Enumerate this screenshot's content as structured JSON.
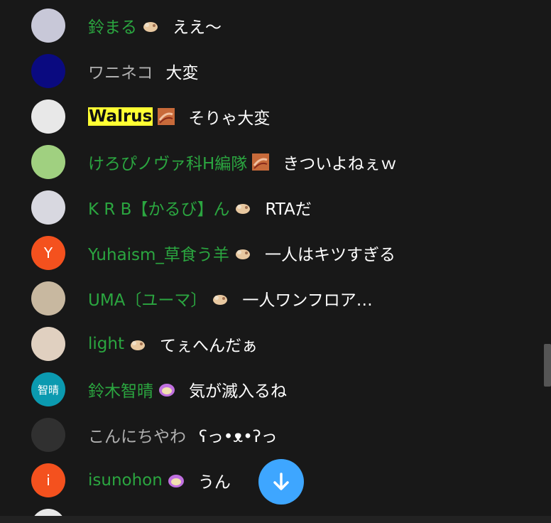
{
  "chat": {
    "messages": [
      {
        "author": "鈴まる",
        "badge": "member-badge-icon",
        "text": "ええ〜",
        "author_style": "member",
        "avatar": {
          "color": "#c8c8d8",
          "label": ""
        }
      },
      {
        "author": "ワニネコ",
        "badge": "",
        "text": "大変",
        "author_style": "plain",
        "avatar": {
          "color": "#0a0a80",
          "label": ""
        }
      },
      {
        "author": "Walrus",
        "badge": "bacon-badge-icon",
        "text": "そりゃ大変",
        "author_style": "owner",
        "avatar": {
          "color": "#e8e8e8",
          "label": ""
        }
      },
      {
        "author": "けろぴノヴァ科H編隊",
        "badge": "bacon-badge-icon",
        "text": "きついよねぇｗ",
        "author_style": "member",
        "avatar": {
          "color": "#a0d080",
          "label": ""
        }
      },
      {
        "author": "K R B【かるび】ん",
        "badge": "member-badge-icon",
        "text": "RTAだ",
        "author_style": "member",
        "avatar": {
          "color": "#d8d8e0",
          "label": ""
        }
      },
      {
        "author": "Yuhaism_草食う羊",
        "badge": "member-badge-icon",
        "text": "一人はキツすぎる",
        "author_style": "member",
        "avatar": {
          "color": "#f4511e",
          "label": "Y"
        }
      },
      {
        "author": "UMA〔ユーマ〕",
        "badge": "member-badge-icon",
        "text": "一人ワンフロア…",
        "author_style": "member",
        "avatar": {
          "color": "#c8b8a0",
          "label": ""
        }
      },
      {
        "author": "light",
        "badge": "member-badge-icon",
        "text": "てぇへんだぁ",
        "author_style": "member",
        "avatar": {
          "color": "#e0d0c0",
          "label": ""
        }
      },
      {
        "author": "鈴木智晴",
        "badge": "purple-badge-icon",
        "text": "気が滅入るね",
        "author_style": "member",
        "avatar": {
          "color": "#0b9ab0",
          "label": "智晴"
        }
      },
      {
        "author": "こんにちやわ",
        "badge": "",
        "text": "ʕっ•ᴥ•ʔっ",
        "author_style": "plain",
        "avatar": {
          "color": "#303030",
          "label": ""
        }
      },
      {
        "author": "isunohon",
        "badge": "purple-badge-icon",
        "text": "うん",
        "author_style": "member",
        "avatar": {
          "color": "#f4511e",
          "label": "i"
        }
      }
    ]
  },
  "colors": {
    "background": "#181818",
    "member_name": "#2ba640",
    "plain_name": "#b0b0b0",
    "owner_highlight": "#ffff33",
    "scroll_button": "#3ea6ff"
  },
  "scroll_down_button": {
    "icon": "arrow-down-icon"
  }
}
